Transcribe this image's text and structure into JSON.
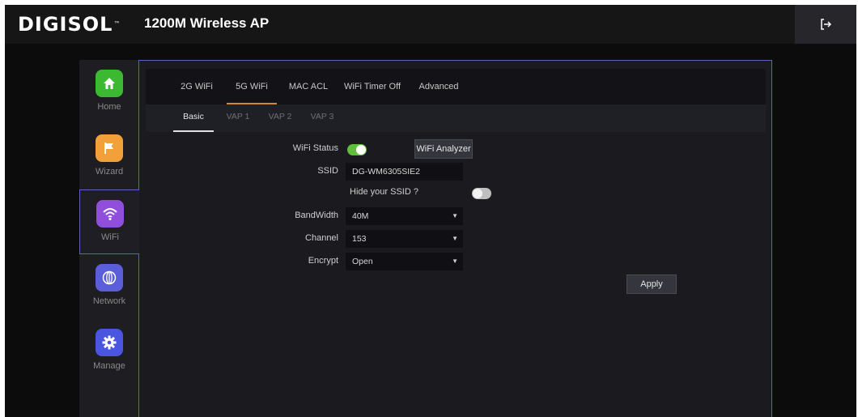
{
  "header": {
    "logo": "DIGISOL",
    "logo_tm": "™",
    "title": "1200M Wireless AP"
  },
  "sidebar": {
    "items": [
      {
        "label": "Home",
        "icon": "home-icon",
        "color": "#3cb832"
      },
      {
        "label": "Wizard",
        "icon": "flag-icon",
        "color": "#f2a03a"
      },
      {
        "label": "WiFi",
        "icon": "wifi-icon",
        "color": "#8f4fdc",
        "active": true
      },
      {
        "label": "Network",
        "icon": "globe-icon",
        "color": "#5a5fd9"
      },
      {
        "label": "Manage",
        "icon": "gear-icon",
        "color": "#4a55e0"
      }
    ]
  },
  "tabs": [
    "2G WiFi",
    "5G WiFi",
    "MAC ACL",
    "WiFi Timer Off",
    "Advanced"
  ],
  "active_tab": "5G WiFi",
  "subtabs": [
    "Basic",
    "VAP 1",
    "VAP 2",
    "VAP 3"
  ],
  "active_subtab": "Basic",
  "form": {
    "wifi_status_label": "WiFi Status",
    "wifi_status": "on",
    "analyzer_button": "WiFi Analyzer",
    "ssid_label": "SSID",
    "ssid_value": "DG-WM6305SIE2",
    "hide_ssid_label": "Hide your SSID ?",
    "hide_ssid": "off",
    "bandwidth_label": "BandWidth",
    "bandwidth_value": "40M",
    "channel_label": "Channel",
    "channel_value": "153",
    "encrypt_label": "Encrypt",
    "encrypt_value": "Open",
    "apply_button": "Apply"
  },
  "colors": {
    "accent_border": "#5a62c8",
    "tab_active_underline": "#d08a30",
    "toggle_on": "#5fbf3a"
  }
}
